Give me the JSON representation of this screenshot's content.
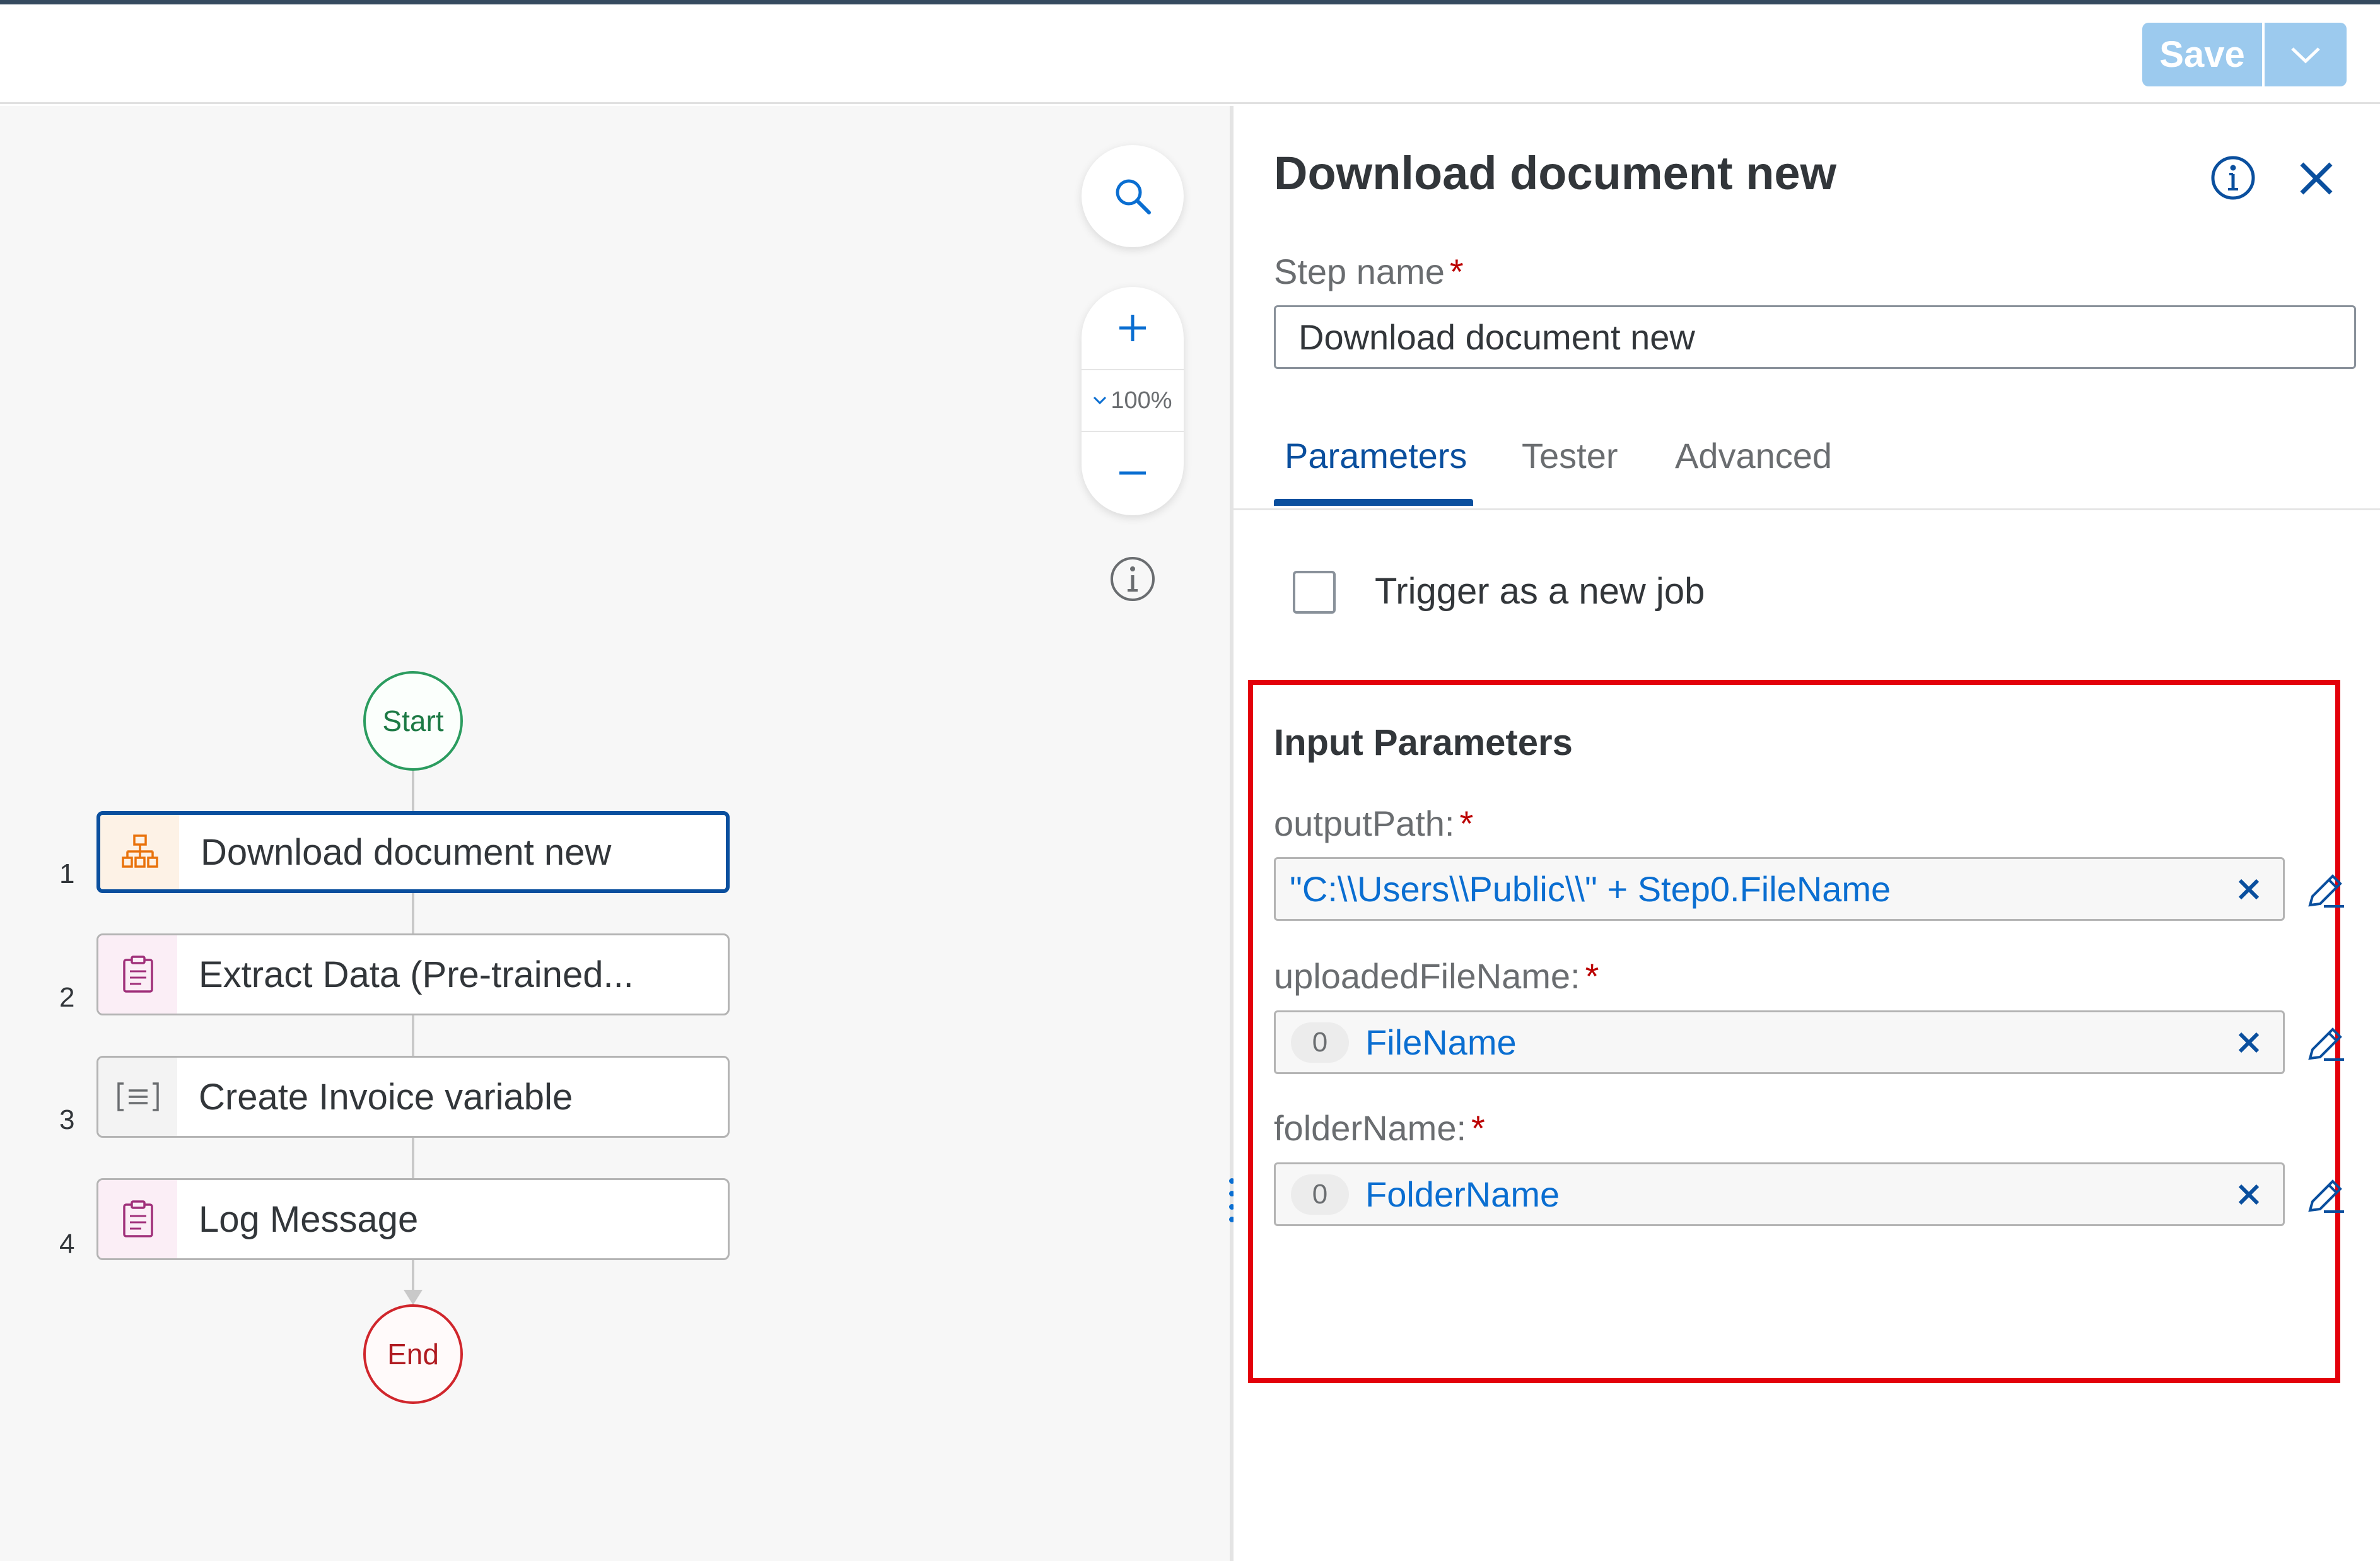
{
  "header": {
    "save_label": "Save"
  },
  "canvas": {
    "zoom_level": "100%",
    "start_label": "Start",
    "end_label": "End",
    "steps": [
      {
        "number": "1",
        "label": "Download document new",
        "icon": "process-icon",
        "selected": true
      },
      {
        "number": "2",
        "label": "Extract Data (Pre-trained...",
        "icon": "clipboard-icon",
        "selected": false
      },
      {
        "number": "3",
        "label": "Create Invoice variable",
        "icon": "variable-icon",
        "selected": false
      },
      {
        "number": "4",
        "label": "Log Message",
        "icon": "clipboard-icon",
        "selected": false
      }
    ]
  },
  "panel": {
    "title": "Download document new",
    "step_name_label": "Step name",
    "required_mark": "*",
    "step_name_value": "Download document new",
    "tabs": [
      "Parameters",
      "Tester",
      "Advanced"
    ],
    "active_tab": "Parameters",
    "trigger_label": "Trigger as a new job",
    "input_params_title": "Input Parameters",
    "params": [
      {
        "label": "outputPath:",
        "value": "\"C:\\\\Users\\\\Public\\\\\" + Step0.FileName",
        "badge": ""
      },
      {
        "label": "uploadedFileName:",
        "value": "FileName",
        "badge": "0"
      },
      {
        "label": "folderName:",
        "value": "FolderName",
        "badge": "0"
      }
    ]
  },
  "colors": {
    "accent": "#0a4f9e",
    "link": "#0a6ed1",
    "save_button": "#9ccaee",
    "highlight": "#e3000b",
    "required": "#bb0000",
    "start": "#2b9c5f",
    "end": "#d0262c"
  }
}
